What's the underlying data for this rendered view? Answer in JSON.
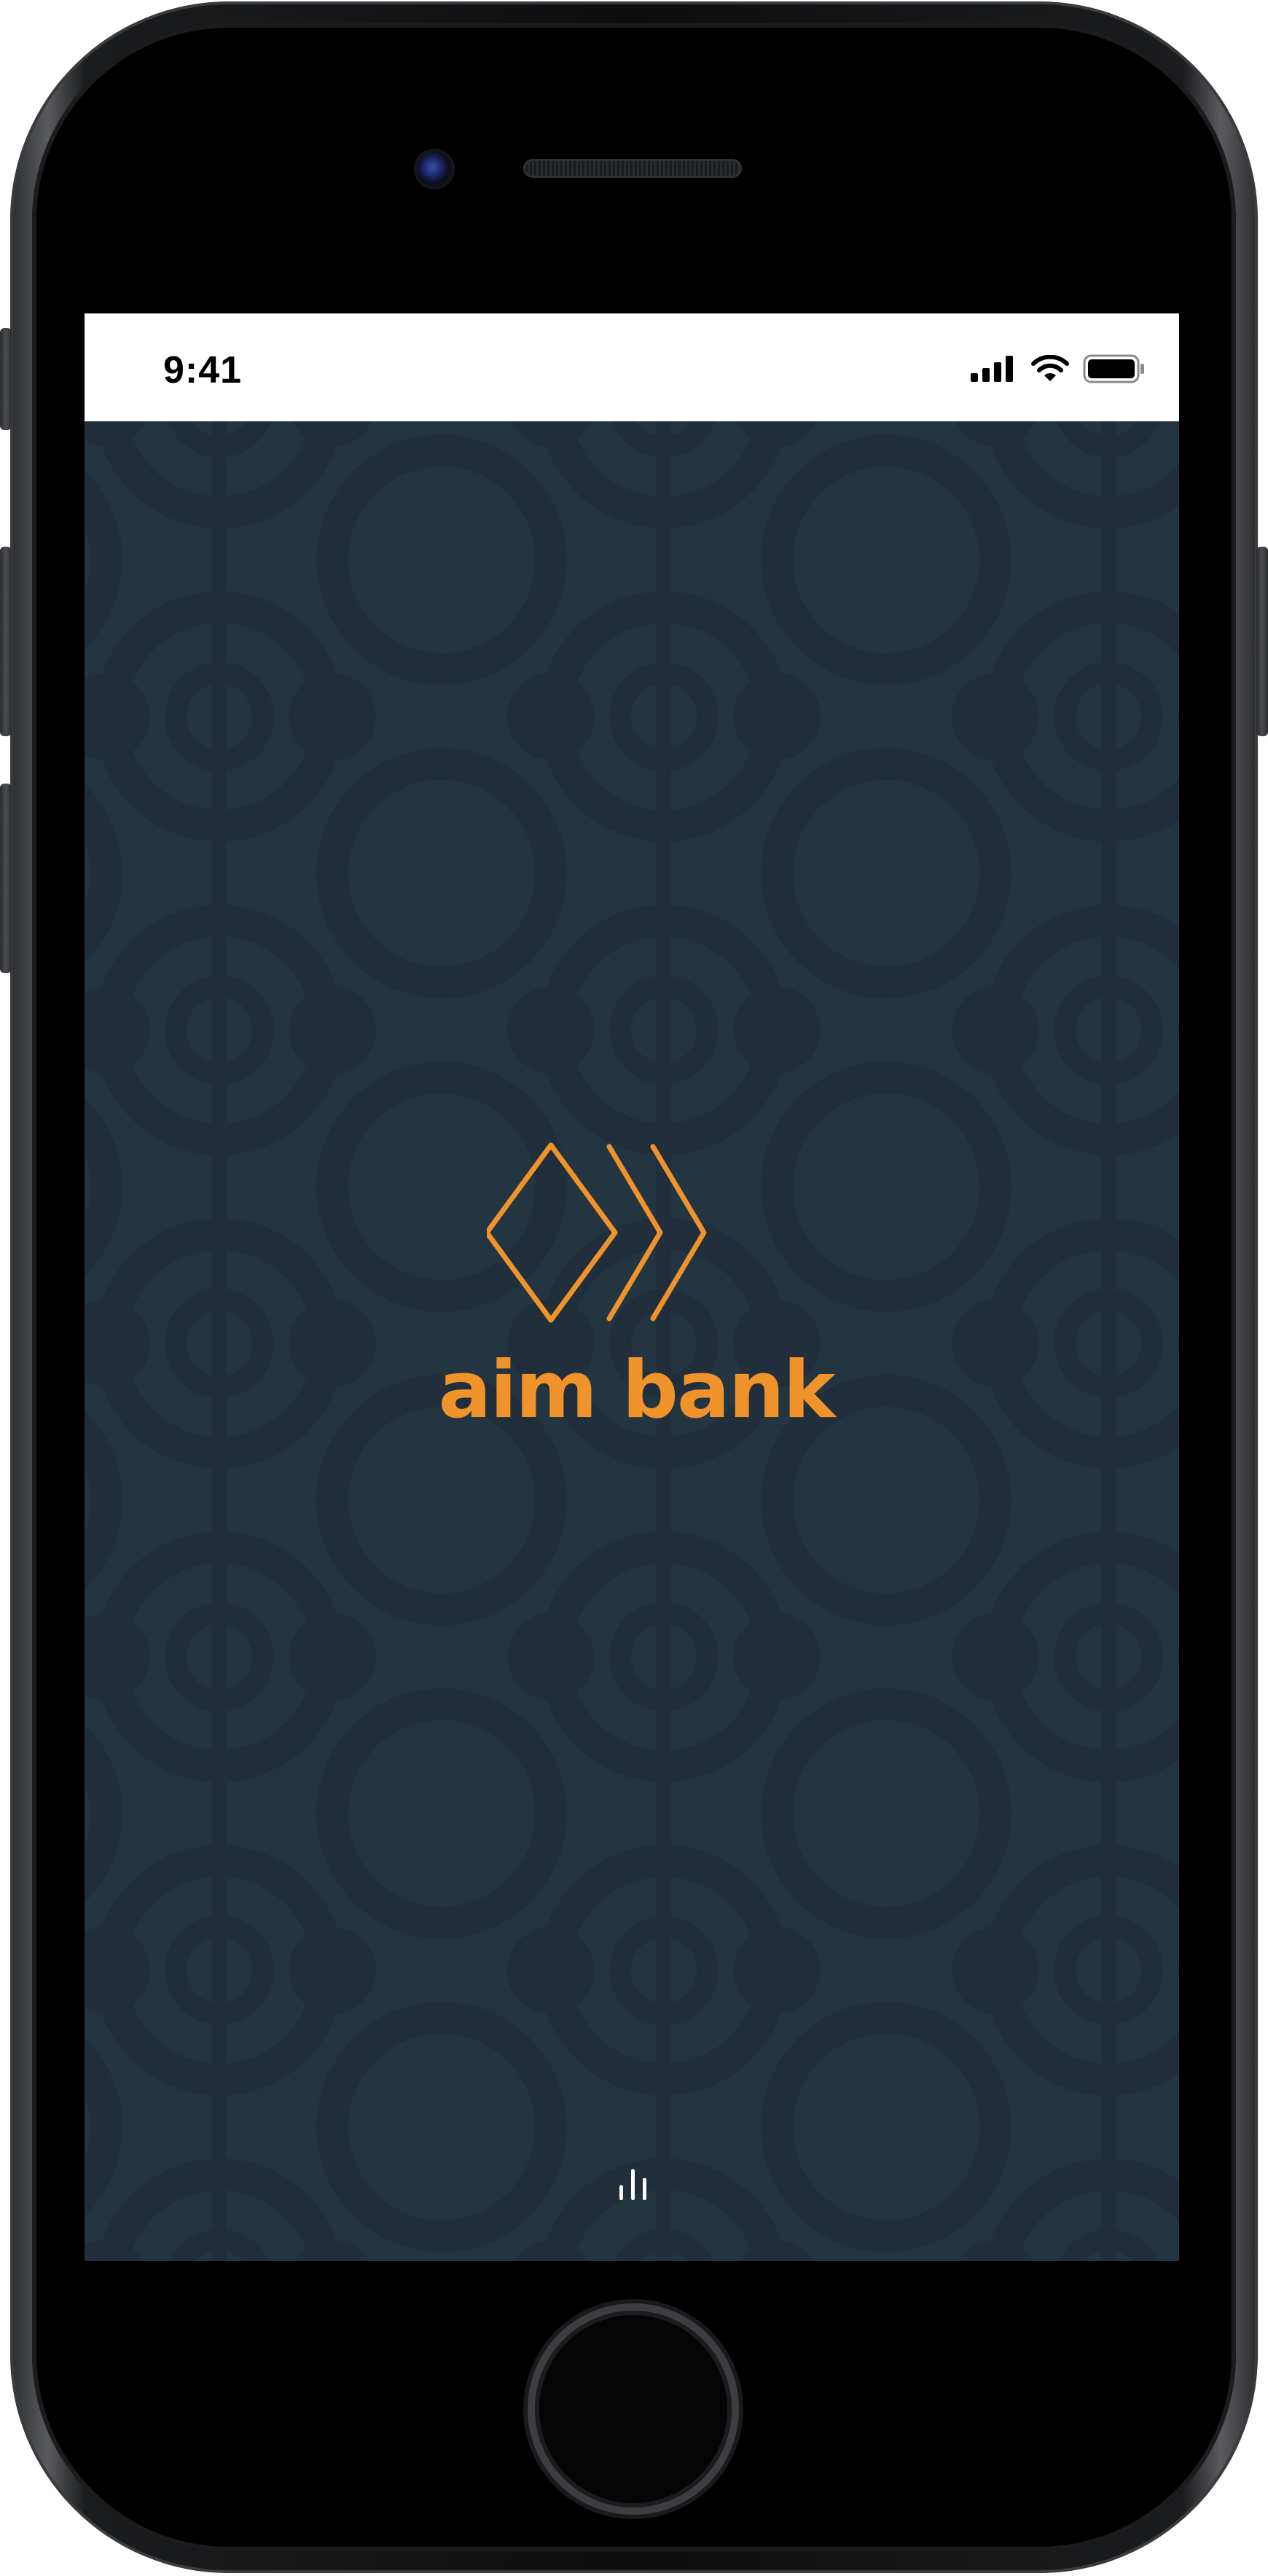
{
  "status_bar": {
    "time": "9:41",
    "icons": [
      "signal-icon",
      "wifi-icon",
      "battery-icon"
    ]
  },
  "splash": {
    "brand_name": "aim bank",
    "logo_icon": "aim-bank-logo-icon",
    "loading_icon": "loading-bars-icon"
  },
  "colors": {
    "background": "#243542",
    "pattern": "#1f2e3a",
    "accent": "#f0932b",
    "status_bar": "#ffffff"
  }
}
